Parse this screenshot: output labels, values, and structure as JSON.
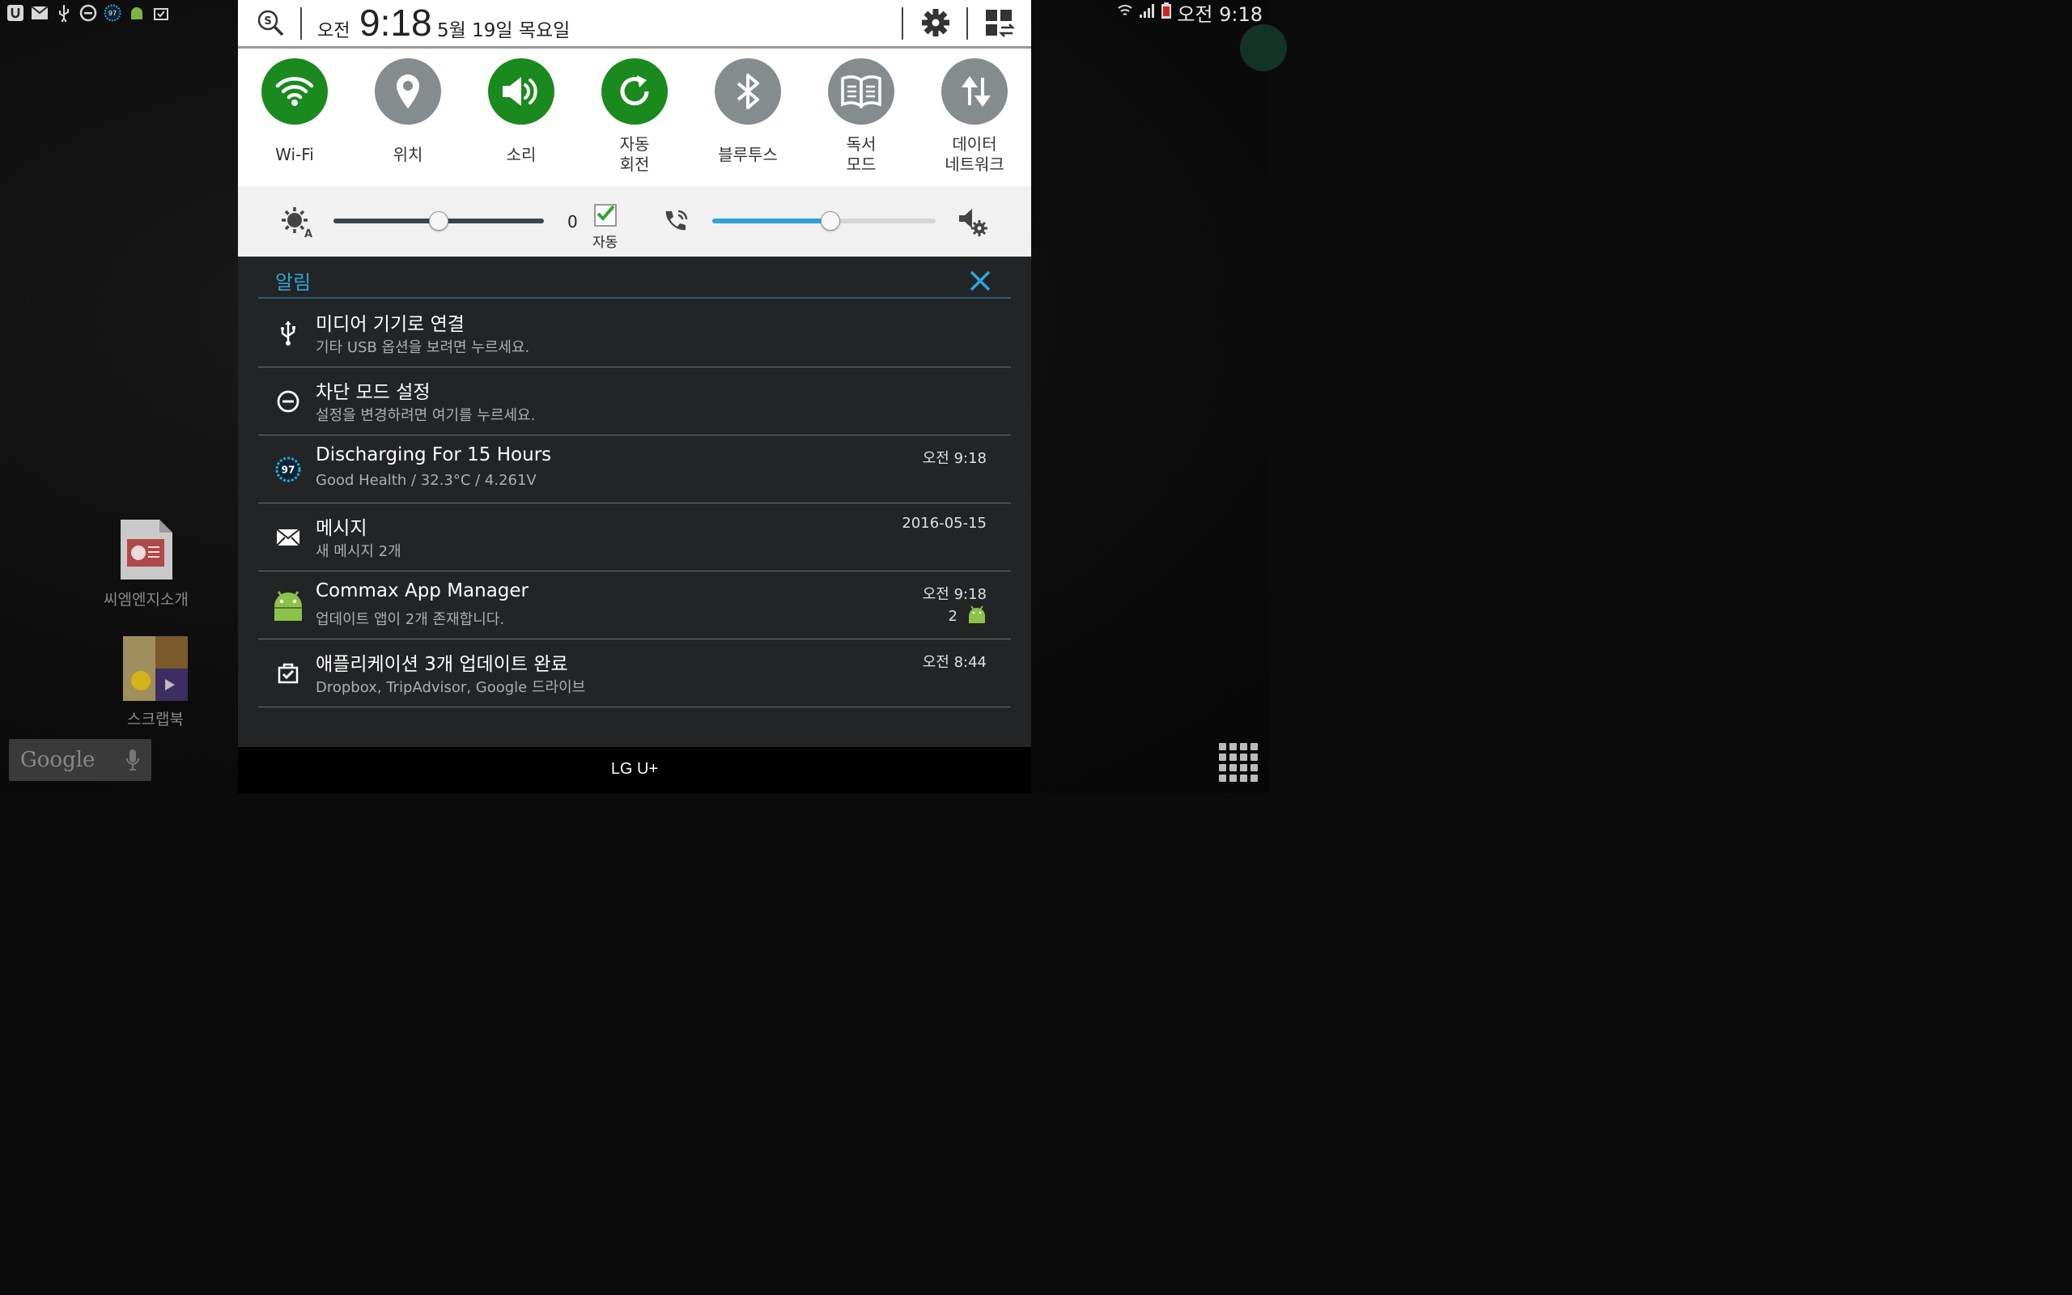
{
  "status_bar": {
    "left_icons": [
      "u-plus-icon",
      "mail-icon",
      "usb-icon",
      "block-mode-icon",
      "battery-97-icon",
      "android-icon",
      "update-icon"
    ],
    "battery_badge": "97",
    "time": "오전 9:18"
  },
  "desktop": {
    "icons": [
      {
        "label": "씨엠엔지소개"
      },
      {
        "label": "스크랩북"
      }
    ],
    "google_search": "Google"
  },
  "header": {
    "ampm": "오전",
    "clock": "9:18",
    "date": "5월 19일 목요일"
  },
  "quick_settings": [
    {
      "label": "Wi-Fi",
      "icon": "wifi-icon",
      "on": true
    },
    {
      "label": "위치",
      "icon": "location-icon",
      "on": false
    },
    {
      "label": "소리",
      "icon": "sound-icon",
      "on": true
    },
    {
      "label": "자동\n회전",
      "icon": "rotate-icon",
      "on": true
    },
    {
      "label": "블루투스",
      "icon": "bluetooth-icon",
      "on": false
    },
    {
      "label": "독서\n모드",
      "icon": "book-icon",
      "on": false
    },
    {
      "label": "데이터\n네트워크",
      "icon": "data-network-icon",
      "on": false
    }
  ],
  "brightness": {
    "value": "0",
    "level": 0.5,
    "auto_label": "자동",
    "auto_checked": true
  },
  "volume": {
    "level": 0.53
  },
  "notifications": {
    "title": "알림",
    "items": [
      {
        "icon": "usb-icon",
        "title": "미디어 기기로 연결",
        "subtitle": "기타 USB 옵션을 보려면 누르세요.",
        "time": "",
        "count": ""
      },
      {
        "icon": "block-mode-icon",
        "title": "차단 모드 설정",
        "subtitle": "설정을 변경하려면 여기를 누르세요.",
        "time": "",
        "count": ""
      },
      {
        "icon": "battery-97-icon",
        "title": "Discharging For 15 Hours",
        "subtitle": "Good Health / 32.3°C / 4.261V",
        "time": "오전 9:18",
        "count": ""
      },
      {
        "icon": "mail-icon",
        "title": "메시지",
        "subtitle": "새 메시지 2개",
        "time": "2016-05-15",
        "count": ""
      },
      {
        "icon": "android-icon",
        "title": "Commax App Manager",
        "subtitle": "업데이트 앱이 2개 존재합니다.",
        "time": "오전 9:18",
        "count": "2"
      },
      {
        "icon": "update-icon",
        "title": "애플리케이션 3개 업데이트 완료",
        "subtitle": "Dropbox, TripAdvisor, Google 드라이브",
        "time": "오전 8:44",
        "count": ""
      }
    ]
  },
  "carrier": "LG U+",
  "colors": {
    "accent": "#2ea4d6",
    "toggle_on": "#1a8a1e",
    "toggle_off": "#868c8e",
    "volume": "#2ea4d6"
  }
}
